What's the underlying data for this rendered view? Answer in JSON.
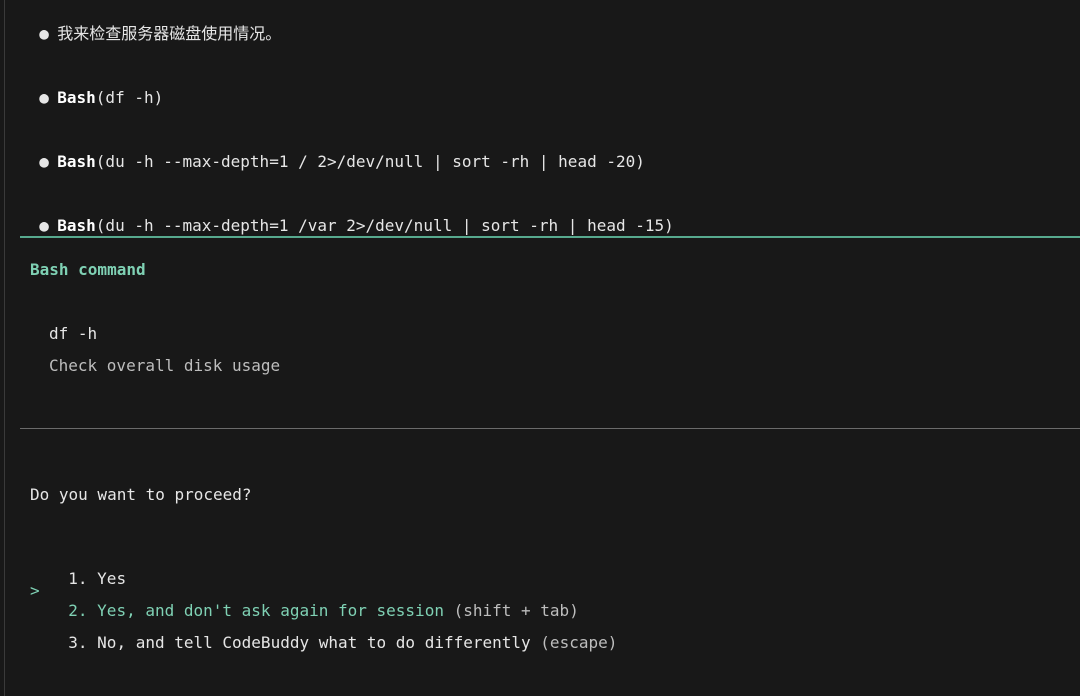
{
  "colors": {
    "background": "#181818",
    "accent": "#7fd1b4",
    "separator_green": "#57a98e",
    "separator_gray": "#6b6b6b"
  },
  "transcript": [
    {
      "bullet": "●",
      "text": "我来检查服务器磁盘使用情况。"
    },
    {
      "bullet": "●",
      "tool": "Bash",
      "args": "(df -h)"
    },
    {
      "bullet": "●",
      "tool": "Bash",
      "args": "(du -h --max-depth=1 / 2>/dev/null | sort -rh | head -20)"
    },
    {
      "bullet": "●",
      "tool": "Bash",
      "args": "(du -h --max-depth=1 /var 2>/dev/null | sort -rh | head -15)"
    }
  ],
  "permission_box": {
    "title": "Bash command",
    "command": "df -h",
    "description": "Check overall disk usage"
  },
  "prompt": {
    "question": "Do you want to proceed?",
    "selector": ">",
    "options": [
      {
        "number": "1.",
        "label": "Yes",
        "hint": ""
      },
      {
        "number": "2.",
        "label": "Yes, and don't ask again for session",
        "hint": "(shift + tab)"
      },
      {
        "number": "3.",
        "label": "No, and tell CodeBuddy what to do differently",
        "hint": "(escape)"
      }
    ]
  }
}
